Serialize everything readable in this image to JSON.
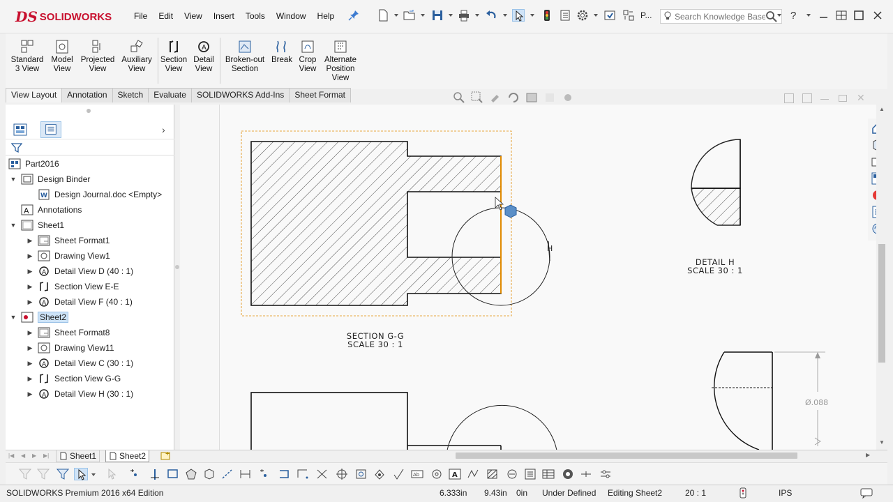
{
  "app": {
    "logo_ds": "DS",
    "logo_text": "SOLIDWORKS",
    "menu": [
      "File",
      "Edit",
      "View",
      "Insert",
      "Tools",
      "Window",
      "Help"
    ],
    "search_placeholder": "Search Knowledge Base",
    "toolbar_truncated_label": "P..."
  },
  "ribbon": {
    "buttons": [
      {
        "label1": "Standard",
        "label2": "3 View"
      },
      {
        "label1": "Model",
        "label2": "View"
      },
      {
        "label1": "Projected",
        "label2": "View"
      },
      {
        "label1": "Auxiliary",
        "label2": "View"
      },
      {
        "label1": "Section",
        "label2": "View"
      },
      {
        "label1": "Detail",
        "label2": "View"
      },
      {
        "label1": "Broken-out",
        "label2": "Section"
      },
      {
        "label1": "Break",
        "label2": ""
      },
      {
        "label1": "Crop",
        "label2": "View"
      },
      {
        "label1": "Alternate",
        "label2": "Position",
        "label3": "View"
      }
    ]
  },
  "tabs": [
    "View Layout",
    "Annotation",
    "Sketch",
    "Evaluate",
    "SOLIDWORKS Add-Ins",
    "Sheet Format"
  ],
  "tree": {
    "root": "Part2016",
    "items": [
      {
        "label": "Design Binder"
      },
      {
        "label": "Design Journal.doc <Empty>"
      },
      {
        "label": "Annotations"
      },
      {
        "label": "Sheet1"
      },
      {
        "label": "Sheet Format1"
      },
      {
        "label": "Drawing View1"
      },
      {
        "label": "Detail View D (40 : 1)"
      },
      {
        "label": "Section View E-E"
      },
      {
        "label": "Detail View F (40 : 1)"
      },
      {
        "label": "Sheet2"
      },
      {
        "label": "Sheet Format8"
      },
      {
        "label": "Drawing View11"
      },
      {
        "label": "Detail View C (30 : 1)"
      },
      {
        "label": "Section View G-G"
      },
      {
        "label": "Detail View H (30 : 1)"
      }
    ]
  },
  "drawing": {
    "section_label": "SECTION G-G",
    "section_scale": "SCALE 30 : 1",
    "detail_label": "DETAIL H",
    "detail_scale": "SCALE 30 : 1",
    "circle_letter": "H",
    "dimension": "Ø.088"
  },
  "sheet_tabs": [
    "Sheet1",
    "Sheet2"
  ],
  "status": {
    "edition": "SOLIDWORKS Premium 2016 x64 Edition",
    "x": "6.333in",
    "y": "9.43in",
    "z": "0in",
    "definition": "Under Defined",
    "editing": "Editing Sheet2",
    "scale": "20 : 1",
    "units": "IPS"
  },
  "colors": {
    "brand": "#c8102e",
    "selection": "#cde3f7",
    "sketch_orange": "#e08a00"
  }
}
